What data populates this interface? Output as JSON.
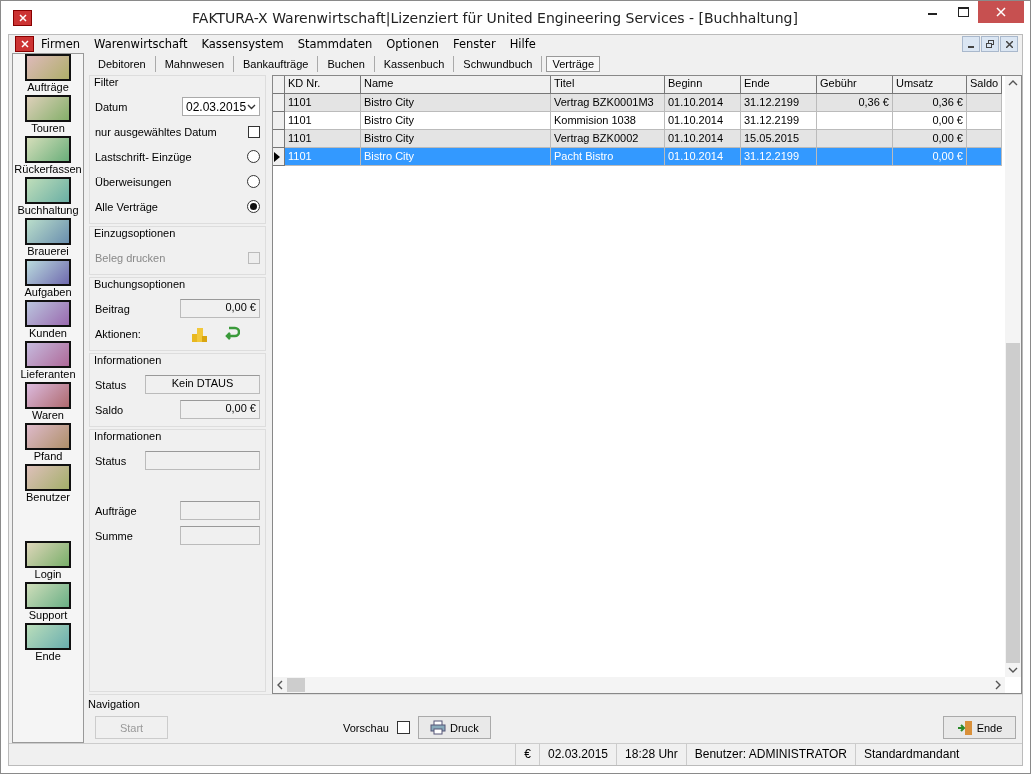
{
  "window": {
    "title": "FAKTURA-X Warenwirtschaft|Lizenziert für United Engineering Services - [Buchhaltung]"
  },
  "menu": [
    "Firmen",
    "Warenwirtschaft",
    "Kassensystem",
    "Stammdaten",
    "Optionen",
    "Fenster",
    "Hilfe"
  ],
  "tabs": [
    {
      "label": "Debitoren",
      "selected": false
    },
    {
      "label": "Mahnwesen",
      "selected": false
    },
    {
      "label": "Bankaufträge",
      "selected": false
    },
    {
      "label": "Buchen",
      "selected": false
    },
    {
      "label": "Kassenbuch",
      "selected": false
    },
    {
      "label": "Schwundbuch",
      "selected": false
    },
    {
      "label": "Verträge",
      "selected": true
    }
  ],
  "sidebar": {
    "items": [
      "Aufträge",
      "Touren",
      "Rückerfassen",
      "Buchhaltung",
      "Brauerei",
      "Aufgaben",
      "Kunden",
      "Lieferanten",
      "Waren",
      "Pfand",
      "Benutzer"
    ],
    "bottom_items": [
      "Login",
      "Support",
      "Ende"
    ]
  },
  "filter": {
    "title": "Filter",
    "date_label": "Datum",
    "date_value": "02.03.2015",
    "options": [
      {
        "kind": "checkbox",
        "label": "nur ausgewähltes Datum",
        "checked": false
      },
      {
        "kind": "radio",
        "label": "Lastschrift- Einzüge",
        "selected": false
      },
      {
        "kind": "radio",
        "label": "Überweisungen",
        "selected": false
      },
      {
        "kind": "radio",
        "label": "Alle Verträge",
        "selected": true
      }
    ]
  },
  "collection_options": {
    "title": "Einzugsoptionen",
    "label": "Beleg drucken",
    "checked": false,
    "disabled": true
  },
  "booking_options": {
    "title": "Buchungsoptionen",
    "amount_label": "Beitrag",
    "amount_value": "0,00 €",
    "actions_label": "Aktionen:"
  },
  "info": {
    "title": "Informationen",
    "status_label": "Status",
    "status_value": "Kein DTAUS",
    "saldo_label": "Saldo",
    "saldo_value": "0,00 €"
  },
  "info2": {
    "title": "Informationen",
    "status_label": "Status",
    "orders_label": "Aufträge",
    "sum_label": "Summe"
  },
  "table": {
    "columns": [
      "KD Nr.",
      "Name",
      "Titel",
      "Beginn",
      "Ende",
      "Gebühr",
      "Umsatz",
      "Saldo"
    ],
    "rows": [
      {
        "cells": [
          "1101",
          "Bistro City",
          "Vertrag BZK0001M3",
          "01.10.2014",
          "31.12.2199",
          "0,36 €",
          "0,36 €",
          ""
        ],
        "selected": false
      },
      {
        "cells": [
          "1101",
          "Bistro City",
          "Kommision 1038",
          "01.10.2014",
          "31.12.2199",
          "",
          "0,00 €",
          ""
        ],
        "selected": false
      },
      {
        "cells": [
          "1101",
          "Bistro City",
          "Vertrag BZK0002",
          "01.10.2014",
          "15.05.2015",
          "",
          "0,00 €",
          ""
        ],
        "selected": false
      },
      {
        "cells": [
          "1101",
          "Bistro City",
          "Pacht Bistro",
          "01.10.2014",
          "31.12.2199",
          "",
          "0,00 €",
          ""
        ],
        "selected": true
      }
    ]
  },
  "navigation": {
    "title": "Navigation",
    "start_label": "Start",
    "start_disabled": true,
    "preview_label": "Vorschau",
    "preview_checked": false,
    "print_label": "Druck",
    "exit_label": "Ende"
  },
  "status_bar": [
    "€",
    "02.03.2015",
    "18:28 Uhr",
    "Benutzer: ADMINISTRATOR",
    "Standardmandant"
  ]
}
